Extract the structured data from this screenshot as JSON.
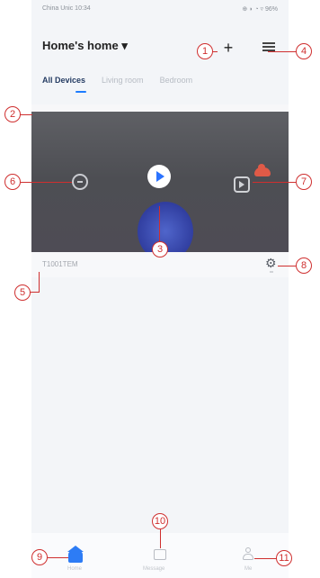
{
  "status_bar": {
    "left": "China Unic 10:34",
    "right": "⊕ ◗ ◔ ▿ 96%"
  },
  "header": {
    "home_title": "Home's home ▾"
  },
  "tabs": [
    {
      "label": "All Devices",
      "active": true
    },
    {
      "label": "Living room",
      "active": false
    },
    {
      "label": "Bedroom",
      "active": false
    }
  ],
  "device": {
    "name": "T1001TEM"
  },
  "bottom_nav": [
    {
      "label": "Home"
    },
    {
      "label": "Message"
    },
    {
      "label": "Me"
    }
  ],
  "callouts": [
    "1",
    "2",
    "3",
    "4",
    "5",
    "6",
    "7",
    "8",
    "9",
    "10",
    "11"
  ],
  "colors": {
    "accent": "#2d7cf5",
    "callout": "#cf2f2f",
    "video_bg": "#58595e",
    "cloud": "#e05a47"
  }
}
